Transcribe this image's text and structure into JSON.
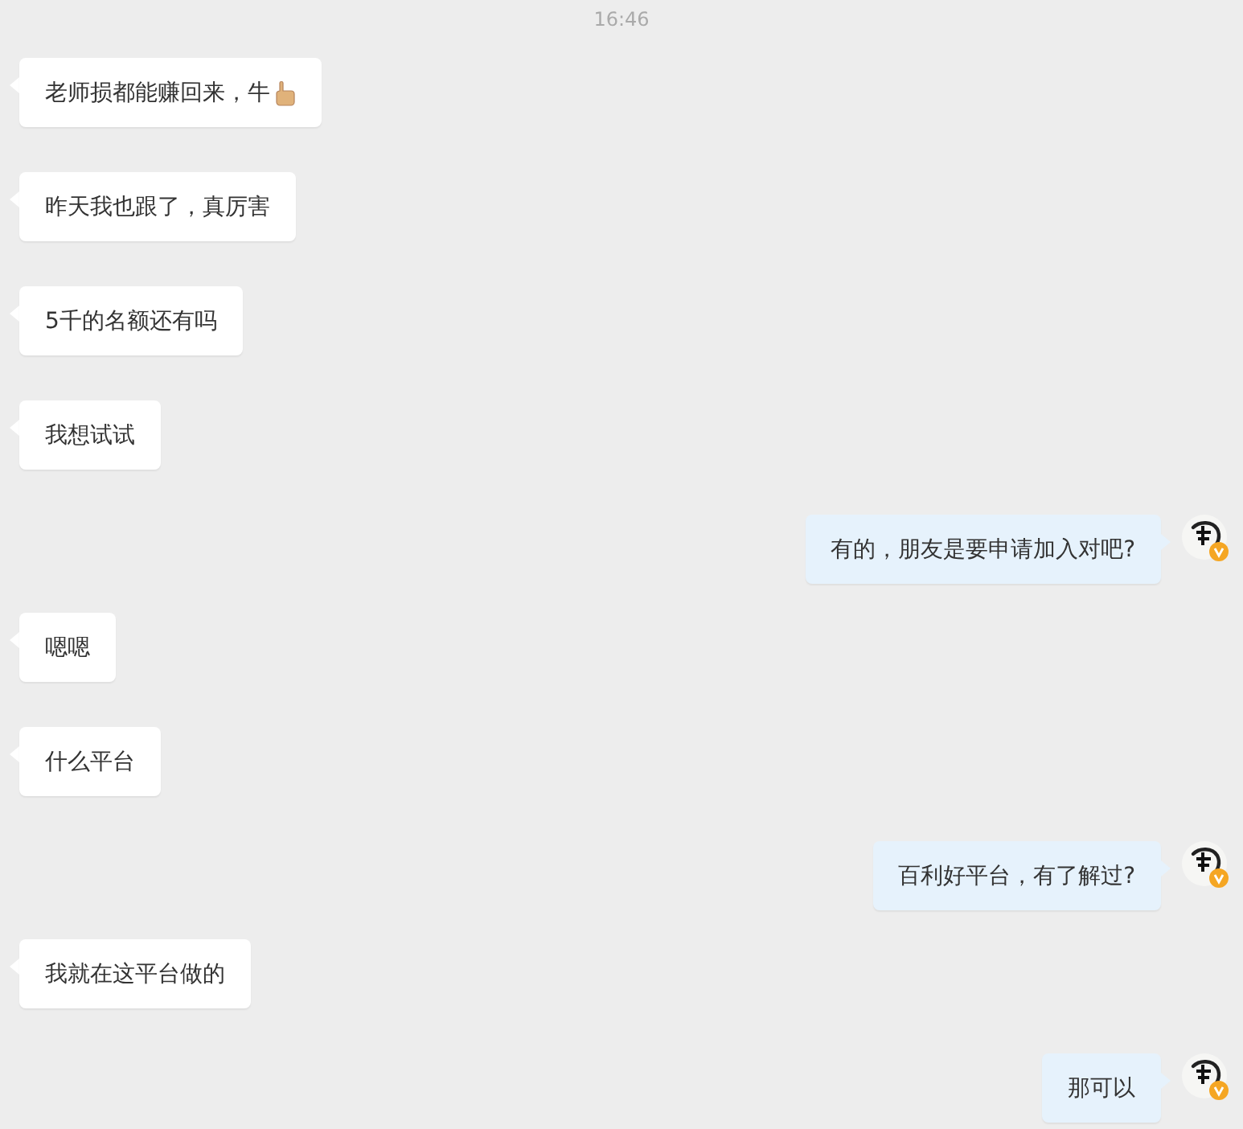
{
  "time": "16:46",
  "messages": [
    {
      "kind": "received",
      "text": "老师损都能赚回来，牛",
      "thumbs_up": true
    },
    {
      "kind": "received",
      "text": "昨天我也跟了，真厉害"
    },
    {
      "kind": "received",
      "text": "5千的名额还有吗"
    },
    {
      "kind": "received",
      "text": "我想试试"
    },
    {
      "kind": "sent",
      "text": "有的，朋友是要申请加入对吧?",
      "verified": true
    },
    {
      "kind": "received",
      "text": "嗯嗯"
    },
    {
      "kind": "received",
      "text": "什么平台"
    },
    {
      "kind": "sent",
      "text": "百利好平台，有了解过?",
      "verified": true
    },
    {
      "kind": "received",
      "text": "我就在这平台做的"
    },
    {
      "kind": "sent",
      "text": "那可以",
      "verified": true
    }
  ]
}
